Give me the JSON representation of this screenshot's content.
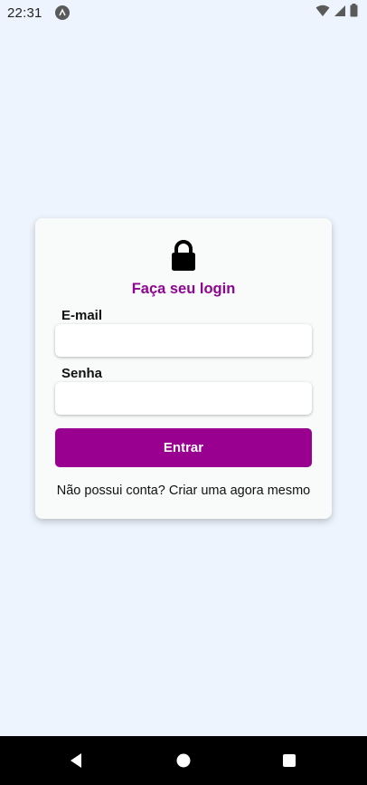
{
  "status_bar": {
    "time": "22:31",
    "icons": [
      "app-notification-icon",
      "wifi-icon",
      "cellular-signal-icon",
      "battery-icon"
    ]
  },
  "login_card": {
    "icon": "lock-icon",
    "title": "Faça seu login",
    "email_label": "E-mail",
    "email_value": "",
    "email_placeholder": "",
    "password_label": "Senha",
    "password_value": "",
    "password_placeholder": "",
    "submit_label": "Entrar",
    "signup_prompt": "Não possui conta?",
    "signup_link": "Criar uma agora mesmo"
  },
  "colors": {
    "accent": "#990090",
    "title": "#8e0591",
    "background": "#eef4fd",
    "card": "#f8fbfa"
  },
  "nav_bar": {
    "icons": [
      "back-icon",
      "home-icon",
      "recents-icon"
    ]
  }
}
